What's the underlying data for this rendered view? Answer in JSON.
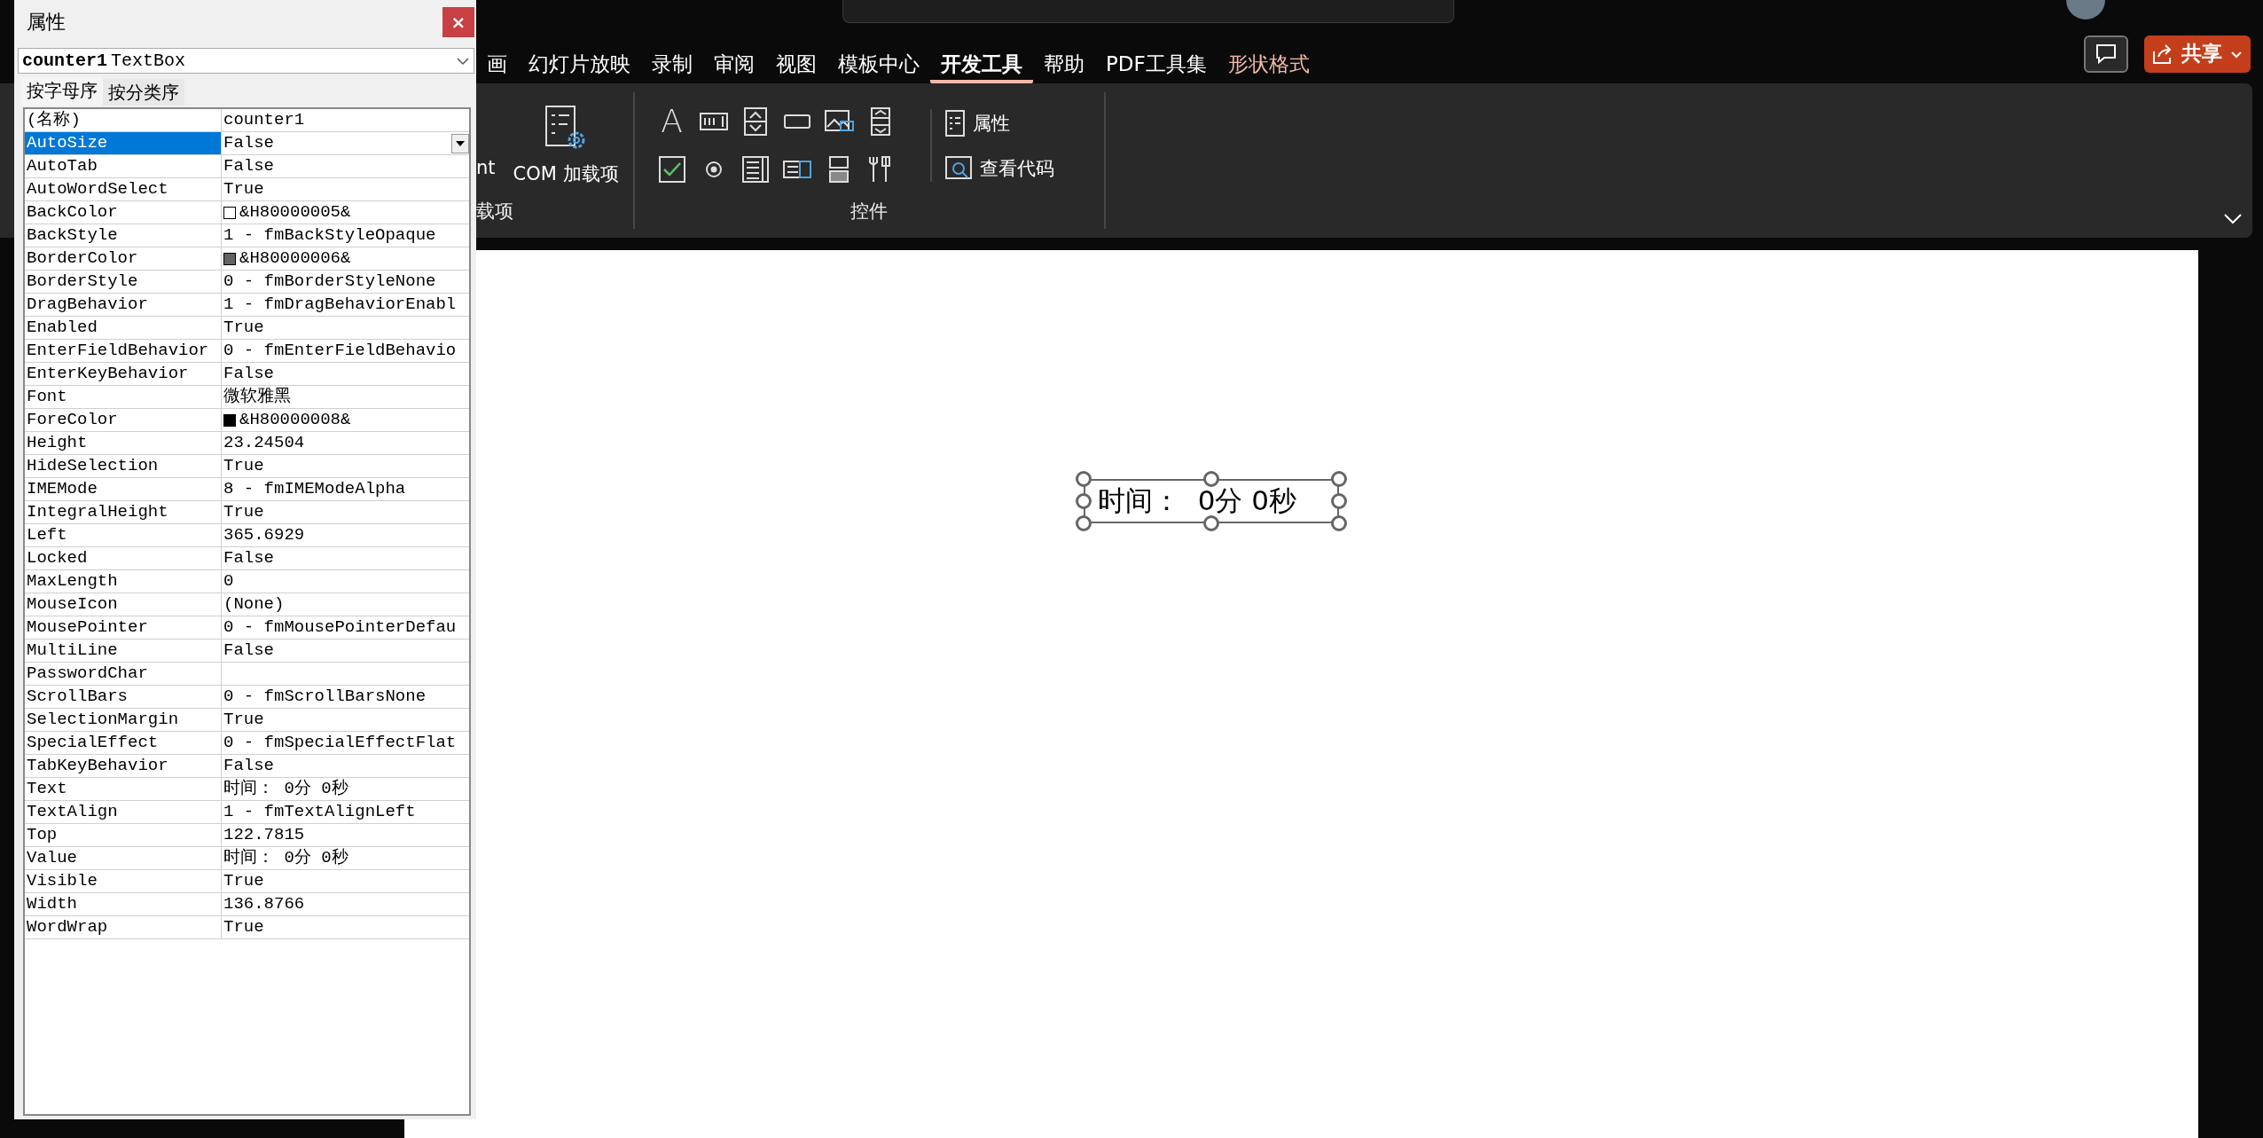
{
  "ribbon_tabs": [
    {
      "label": "画",
      "selected": false,
      "kind": "normal"
    },
    {
      "label": "幻灯片放映",
      "selected": false,
      "kind": "normal"
    },
    {
      "label": "录制",
      "selected": false,
      "kind": "normal"
    },
    {
      "label": "审阅",
      "selected": false,
      "kind": "normal"
    },
    {
      "label": "视图",
      "selected": false,
      "kind": "normal"
    },
    {
      "label": "模板中心",
      "selected": false,
      "kind": "normal"
    },
    {
      "label": "开发工具",
      "selected": true,
      "kind": "normal"
    },
    {
      "label": "帮助",
      "selected": false,
      "kind": "normal"
    },
    {
      "label": "PDF工具集",
      "selected": false,
      "kind": "normal"
    },
    {
      "label": "形状格式",
      "selected": false,
      "kind": "contextual"
    }
  ],
  "share_button": {
    "label": "共享"
  },
  "ribbon": {
    "addins_group": {
      "partial_button": "nt",
      "com_button": "COM 加载项",
      "label": "载项"
    },
    "controls_group": {
      "label": "控件",
      "label_tool": "A",
      "properties_button": "属性",
      "view_code_button": "查看代码"
    }
  },
  "properties_window": {
    "title": "属性",
    "close": "×",
    "object_selector": {
      "name": "counter1",
      "type": "TextBox"
    },
    "tabs": [
      {
        "label": "按字母序",
        "selected": true
      },
      {
        "label": "按分类序",
        "selected": false
      }
    ],
    "rows": [
      {
        "name": "(名称)",
        "value": "counter1",
        "selected": false
      },
      {
        "name": "AutoSize",
        "value": "False",
        "selected": true
      },
      {
        "name": "AutoTab",
        "value": "False",
        "selected": false
      },
      {
        "name": "AutoWordSelect",
        "value": "True",
        "selected": false
      },
      {
        "name": "BackColor",
        "value": "&H80000005&",
        "selected": false,
        "color": "#ffffff"
      },
      {
        "name": "BackStyle",
        "value": "1 - fmBackStyleOpaque",
        "selected": false
      },
      {
        "name": "BorderColor",
        "value": "&H80000006&",
        "selected": false,
        "color": "#646464"
      },
      {
        "name": "BorderStyle",
        "value": "0 - fmBorderStyleNone",
        "selected": false
      },
      {
        "name": "DragBehavior",
        "value": "1 - fmDragBehaviorEnabl",
        "selected": false
      },
      {
        "name": "Enabled",
        "value": "True",
        "selected": false
      },
      {
        "name": "EnterFieldBehavior",
        "value": "0 - fmEnterFieldBehavio",
        "selected": false
      },
      {
        "name": "EnterKeyBehavior",
        "value": "False",
        "selected": false
      },
      {
        "name": "Font",
        "value": "微软雅黑",
        "selected": false
      },
      {
        "name": "ForeColor",
        "value": "&H80000008&",
        "selected": false,
        "color": "#000000"
      },
      {
        "name": "Height",
        "value": "23.24504",
        "selected": false
      },
      {
        "name": "HideSelection",
        "value": "True",
        "selected": false
      },
      {
        "name": "IMEMode",
        "value": "8 - fmIMEModeAlpha",
        "selected": false
      },
      {
        "name": "IntegralHeight",
        "value": "True",
        "selected": false
      },
      {
        "name": "Left",
        "value": "365.6929",
        "selected": false
      },
      {
        "name": "Locked",
        "value": "False",
        "selected": false
      },
      {
        "name": "MaxLength",
        "value": "0",
        "selected": false
      },
      {
        "name": "MouseIcon",
        "value": "(None)",
        "selected": false
      },
      {
        "name": "MousePointer",
        "value": "0 - fmMousePointerDefau",
        "selected": false
      },
      {
        "name": "MultiLine",
        "value": "False",
        "selected": false
      },
      {
        "name": "PasswordChar",
        "selected": false
      },
      {
        "name": "ScrollBars",
        "value": "0 - fmScrollBarsNone",
        "selected": false
      },
      {
        "name": "SelectionMargin",
        "value": "True",
        "selected": false
      },
      {
        "name": "SpecialEffect",
        "value": "0 - fmSpecialEffectFlat",
        "selected": false
      },
      {
        "name": "TabKeyBehavior",
        "value": "False",
        "selected": false
      },
      {
        "name": "Text",
        "value": "时间：  0分 0秒",
        "selected": false
      },
      {
        "name": "TextAlign",
        "value": "1 - fmTextAlignLeft",
        "selected": false
      },
      {
        "name": "Top",
        "value": "122.7815",
        "selected": false
      },
      {
        "name": "Value",
        "value": "时间：  0分 0秒",
        "selected": false
      },
      {
        "name": "Visible",
        "value": "True",
        "selected": false
      },
      {
        "name": "Width",
        "value": "136.8766",
        "selected": false
      },
      {
        "name": "WordWrap",
        "value": "True",
        "selected": false
      }
    ]
  },
  "slide": {
    "textbox": {
      "text": "时间：  0分 0秒",
      "selected": true
    }
  }
}
